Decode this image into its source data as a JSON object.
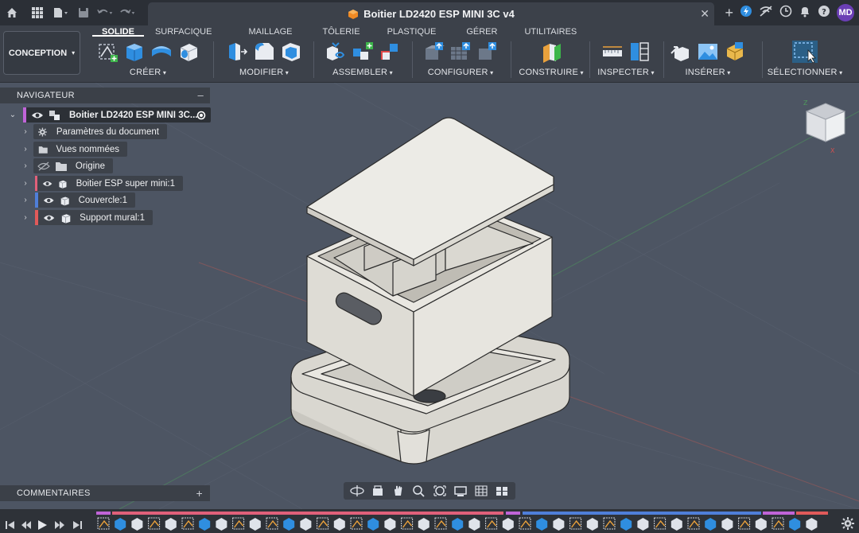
{
  "title_bar": {
    "document_title": "Boitier LD2420 ESP MINI 3C v4",
    "user_initials": "MD",
    "icons_left": [
      "home-icon",
      "grid-icon",
      "file-icon",
      "save-icon",
      "undo-icon",
      "redo-icon"
    ],
    "icons_right": [
      "plus-icon",
      "extension-icon",
      "offline-icon",
      "clock-icon",
      "bell-icon",
      "help-icon"
    ]
  },
  "toolbar": {
    "workspace_label": "CONCEPTION",
    "tabs": [
      {
        "label": "SOLIDE",
        "active": true
      },
      {
        "label": "SURFACIQUE",
        "active": false
      },
      {
        "label": "MAILLAGE",
        "active": false
      },
      {
        "label": "TÔLERIE",
        "active": false
      },
      {
        "label": "PLASTIQUE",
        "active": false
      },
      {
        "label": "GÉRER",
        "active": false
      },
      {
        "label": "UTILITAIRES",
        "active": false
      }
    ],
    "groups": {
      "create": "CRÉER",
      "modify": "MODIFIER",
      "assemble": "ASSEMBLER",
      "configure": "CONFIGURER",
      "construct": "CONSTRUIRE",
      "inspect": "INSPECTER",
      "insert": "INSÉRER",
      "select": "SÉLECTIONNER"
    }
  },
  "browser": {
    "header": "NAVIGATEUR",
    "root": {
      "label": "Boitier LD2420 ESP MINI 3C...",
      "color": "#c064d8"
    },
    "items": [
      {
        "label": "Paramètres du document",
        "icon": "gear-icon"
      },
      {
        "label": "Vues nommées",
        "icon": "folder-icon"
      },
      {
        "label": "Origine",
        "icon": "folder-icon",
        "hidden": true
      },
      {
        "label": "Boitier ESP super mini:1",
        "icon": "component-icon",
        "color": "#e0607a"
      },
      {
        "label": "Couvercle:1",
        "icon": "component-icon",
        "color": "#4f7fd9"
      },
      {
        "label": "Support mural:1",
        "icon": "component-icon",
        "color": "#e05a5a"
      }
    ]
  },
  "comments": {
    "label": "COMMENTAIRES"
  },
  "colors": {
    "viewport_bg": "#4d5563",
    "toolbar_bg": "#3c414a",
    "model_light": "#e9e7e1",
    "model_face": "#dcdad3",
    "model_shade": "#bdbab2",
    "edge": "#2b2b2b",
    "accent_blue": "#2f8ee0"
  }
}
